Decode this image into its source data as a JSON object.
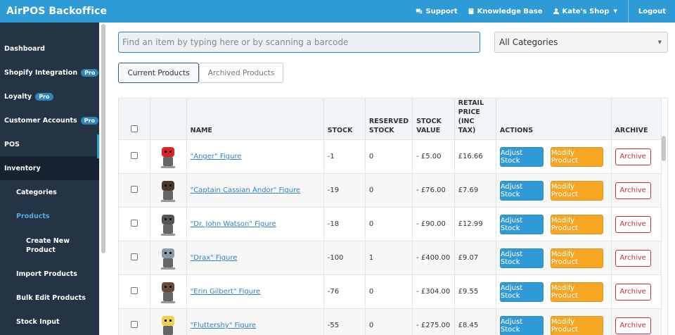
{
  "app": {
    "title": "AirPOS Backoffice"
  },
  "topnav": {
    "support": "Support",
    "knowledge_base": "Knowledge Base",
    "shop": "Kate's Shop",
    "logout": "Logout"
  },
  "sidebar": {
    "items": [
      {
        "label": "Dashboard"
      },
      {
        "label": "Shopify Integration",
        "badge": "Pro"
      },
      {
        "label": "Loyalty",
        "badge": "Pro"
      },
      {
        "label": "Customer Accounts",
        "badge": "Pro"
      },
      {
        "label": "POS"
      },
      {
        "label": "Inventory"
      },
      {
        "label": "Categories"
      },
      {
        "label": "Products"
      },
      {
        "label": "Create New Product"
      },
      {
        "label": "Import Products"
      },
      {
        "label": "Bulk Edit Products"
      },
      {
        "label": "Stock Input"
      }
    ]
  },
  "search": {
    "placeholder": "Find an item by typing here or by scanning a barcode",
    "value": ""
  },
  "category_filter": {
    "selected": "All Categories"
  },
  "tabs": [
    {
      "label": "Current Products",
      "active": true
    },
    {
      "label": "Archived Products",
      "active": false
    }
  ],
  "table": {
    "headers": {
      "name": "NAME",
      "stock": "STOCK",
      "reserved_line1": "RESERVED",
      "reserved_line2": "STOCK",
      "value_line1": "STOCK",
      "value_line2": "VALUE",
      "price_line1": "RETAIL",
      "price_line2": "PRICE",
      "price_line3": "(INC TAX)",
      "actions": "ACTIONS",
      "archive": "ARCHIVE"
    },
    "rows": [
      {
        "name": "\"Anger\" Figure",
        "stock": "-1",
        "reserved": "0",
        "value": "- £5.00",
        "price": "£16.66",
        "icon": "anger-figure",
        "color": "#d22"
      },
      {
        "name": "\"Captain Cassian Andor\" Figure",
        "stock": "-19",
        "reserved": "0",
        "value": "- £76.00",
        "price": "£7.69",
        "icon": "cassian-figure",
        "color": "#4a3a2a"
      },
      {
        "name": "\"Dr. John Watson\" Figure",
        "stock": "-18",
        "reserved": "0",
        "value": "- £90.00",
        "price": "£12.99",
        "icon": "watson-figure",
        "color": "#555"
      },
      {
        "name": "\"Drax\" Figure",
        "stock": "-100",
        "reserved": "1",
        "value": "- £400.00",
        "price": "£9.07",
        "icon": "drax-figure",
        "color": "#8a9aa6"
      },
      {
        "name": "\"Erin Gilbert\" Figure",
        "stock": "-76",
        "reserved": "0",
        "value": "- £304.00",
        "price": "£9.55",
        "icon": "erin-figure",
        "color": "#6b4a3a"
      },
      {
        "name": "\"Fluttershy\" Figure",
        "stock": "-55",
        "reserved": "0",
        "value": "- £275.00",
        "price": "£8.45",
        "icon": "fluttershy-figure",
        "color": "#f3d04a"
      }
    ],
    "action_labels": {
      "adjust": "Adjust Stock",
      "modify": "Modify Product",
      "archive": "Archive"
    }
  },
  "colors": {
    "topbar": "#2f9bd6",
    "sidebar": "#243444",
    "adjust": "#2f9bd6",
    "modify": "#f5a623",
    "archive": "#c9302c"
  }
}
